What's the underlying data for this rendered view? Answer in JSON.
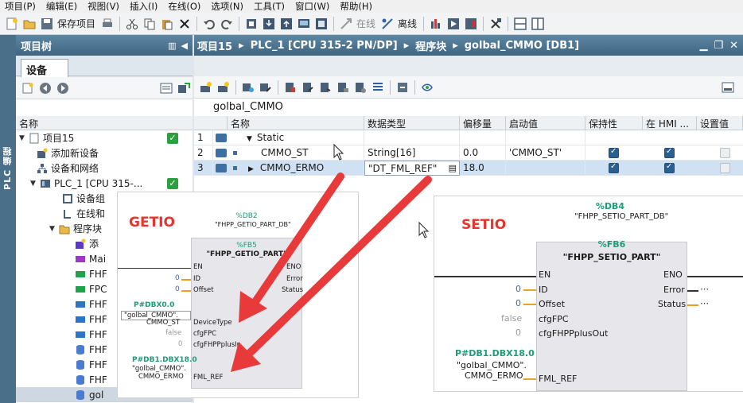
{
  "menu": [
    "项目(P)",
    "编辑(E)",
    "视图(V)",
    "插入(I)",
    "在线(O)",
    "选项(N)",
    "工具(T)",
    "窗口(W)",
    "帮助(H)"
  ],
  "toolbar": {
    "save_project": "保存项目",
    "online": "在线",
    "offline": "离线"
  },
  "vertical_tab": "PLC 编程",
  "tree": {
    "header": "项目树",
    "tab": "设备",
    "column_name": "名称",
    "rows": [
      {
        "label": "项目15"
      },
      {
        "label": "添加新设备"
      },
      {
        "label": "设备和网络"
      },
      {
        "label": "PLC_1 [CPU 315-..."
      },
      {
        "label": "设备组"
      },
      {
        "label": "在线和"
      },
      {
        "label": "程序块"
      },
      {
        "label": "添"
      },
      {
        "label": "Mai"
      },
      {
        "label": "FHF"
      },
      {
        "label": "FPC"
      },
      {
        "label": "FHF"
      },
      {
        "label": "FHF"
      },
      {
        "label": "FHF"
      },
      {
        "label": "FHF"
      },
      {
        "label": "FHF"
      },
      {
        "label": "FHF"
      },
      {
        "label": "gol"
      }
    ]
  },
  "editor": {
    "breadcrumb": [
      "项目15",
      "PLC_1 [CPU 315-2 PN/DP]",
      "程序块",
      "golbal_CMMO [DB1]"
    ],
    "block_name": "golbal_CMMO",
    "columns": [
      "名称",
      "数据类型",
      "偏移量",
      "启动值",
      "保持性",
      "在 HMI ...",
      "设置值"
    ],
    "rows": [
      {
        "num": "1",
        "name": "Static",
        "type": "",
        "offset": "",
        "start": "",
        "retain": false,
        "hmi": false,
        "setval": false
      },
      {
        "num": "2",
        "name": "CMMO_ST",
        "type": "String[16]",
        "offset": "0.0",
        "start": "'CMMO_ST'",
        "retain": true,
        "hmi": true,
        "setval": false
      },
      {
        "num": "3",
        "name": "CMMO_ERMO",
        "type": "\"DT_FML_REF\"",
        "offset": "18.0",
        "start": "",
        "retain": true,
        "hmi": true,
        "setval": false
      }
    ]
  },
  "getio": {
    "label": "GETIO",
    "db": "%DB2",
    "db_name": "\"FHPP_GETIO_PART_DB\"",
    "fb": "%FB5",
    "fb_name": "\"FHPP_GETIO_PART\"",
    "pins_in": [
      "EN",
      "ID",
      "Offset",
      "DeviceType",
      "cfgFPC",
      "cfgFHPPplusIn",
      "FML_REF"
    ],
    "pins_out": [
      "ENO",
      "Error",
      "Status"
    ],
    "val_id": "0",
    "val_offset": "0",
    "dev_addr": "P#DBX0.0",
    "dev_name": "\"golbal_CMMO\".",
    "dev_member": "CMMO_ST",
    "val_fpc": "false",
    "val_fhpp": "0",
    "fml_addr": "P#DB1.DBX18.0",
    "fml_name": "\"golbal_CMMO\".",
    "fml_member": "CMMO_ERMO"
  },
  "setio": {
    "label": "SETIO",
    "db": "%DB4",
    "db_name": "\"FHPP_SETIO_PART_DB\"",
    "fb": "%FB6",
    "fb_name": "\"FHPP_SETIO_PART\"",
    "pins_in": [
      "EN",
      "ID",
      "Offset",
      "cfgFPC",
      "cfgFHPPplusOut",
      "FML_REF"
    ],
    "pins_out": [
      "ENO",
      "Error",
      "Status"
    ],
    "val_id": "0",
    "val_offset": "0",
    "val_fpc": "false",
    "val_fhpp": "0",
    "fml_addr": "P#DB1.DBX18.0",
    "fml_name": "\"golbal_CMMO\".",
    "fml_member": "CMMO_ERMO"
  }
}
